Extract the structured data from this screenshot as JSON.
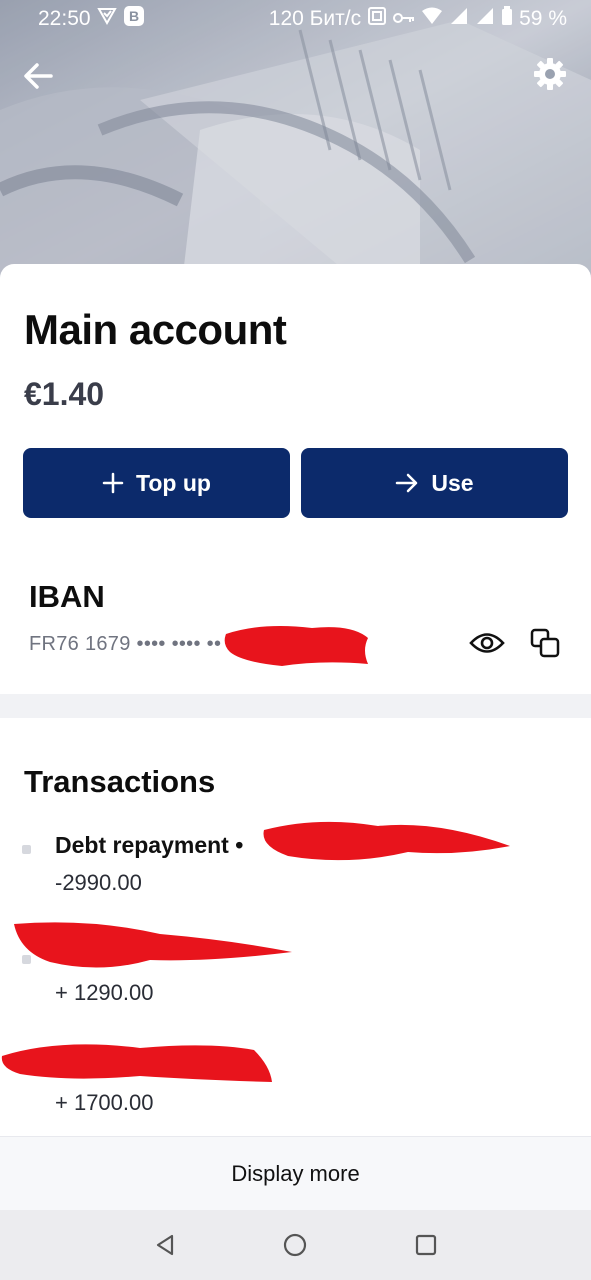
{
  "status_bar": {
    "time": "22:50",
    "network_speed": "120 Бит/с",
    "battery": "59 %"
  },
  "header": {
    "back_icon": "arrow-left-icon",
    "settings_icon": "gear-icon"
  },
  "account": {
    "title": "Main account",
    "balance": "€1.40"
  },
  "actions": {
    "top_up_label": "Top up",
    "use_label": "Use"
  },
  "iban": {
    "label": "IBAN",
    "value": "FR76 1679 •••• •••• ••"
  },
  "transactions": {
    "title": "Transactions",
    "items": [
      {
        "name": "Debt repayment •",
        "amount": "-2990.00"
      },
      {
        "name": "",
        "amount": "+ 1290.00"
      },
      {
        "name": "",
        "amount": "+ 1700.00"
      }
    ],
    "display_more_label": "Display more"
  },
  "colors": {
    "primary_button": "#0c2a6b",
    "redaction": "#e8141c"
  }
}
